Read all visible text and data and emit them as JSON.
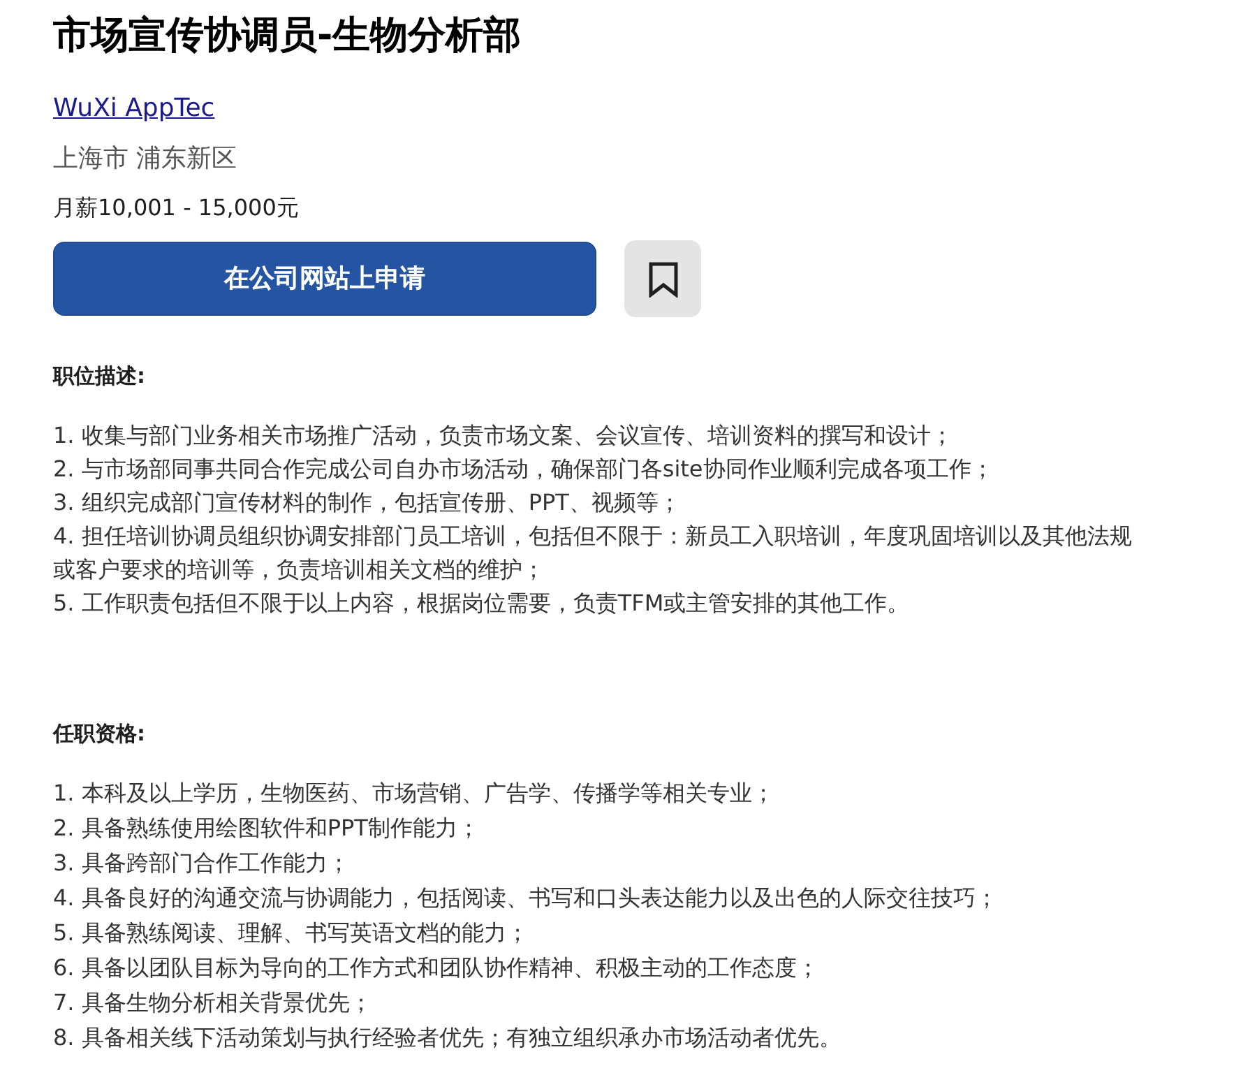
{
  "job": {
    "title": "市场宣传协调员-生物分析部",
    "company": "WuXi AppTec",
    "location": "上海市 浦东新区",
    "salary": "月薪10,001 - 15,000元"
  },
  "actions": {
    "apply": "在公司网站上申请",
    "bookmark_saved": false
  },
  "description": {
    "heading": "职位描述:",
    "lines": [
      "1. 收集与部门业务相关市场推广活动，负责市场文案、会议宣传、培训资料的撰写和设计；",
      "2. 与市场部同事共同合作完成公司自办市场活动，确保部门各site协同作业顺利完成各项工作；",
      "3. 组织完成部门宣传材料的制作，包括宣传册、PPT、视频等；",
      "4. 担任培训协调员组织协调安排部门员工培训，包括但不限于：新员工入职培训，年度巩固培训以及其他法规或客户要求的培训等，负责培训相关文档的维护；",
      "5. 工作职责包括但不限于以上内容，根据岗位需要，负责TFM或主管安排的其他工作。"
    ]
  },
  "requirements": {
    "heading": "任职资格:",
    "lines": [
      "1. 本科及以上学历，生物医药、市场营销、广告学、传播学等相关专业；",
      "2. 具备熟练使用绘图软件和PPT制作能力；",
      "3. 具备跨部门合作工作能力；",
      "4. 具备良好的沟通交流与协调能力，包括阅读、书写和口头表达能力以及出色的人际交往技巧；",
      "5. 具备熟练阅读、理解、书写英语文档的能力；",
      "6. 具备以团队目标为导向的工作方式和团队协作精神、积极主动的工作态度；",
      "7. 具备生物分析相关背景优先；",
      "8. 具备相关线下活动策划与执行经验者优先；有独立组织承办市场活动者优先。"
    ]
  }
}
